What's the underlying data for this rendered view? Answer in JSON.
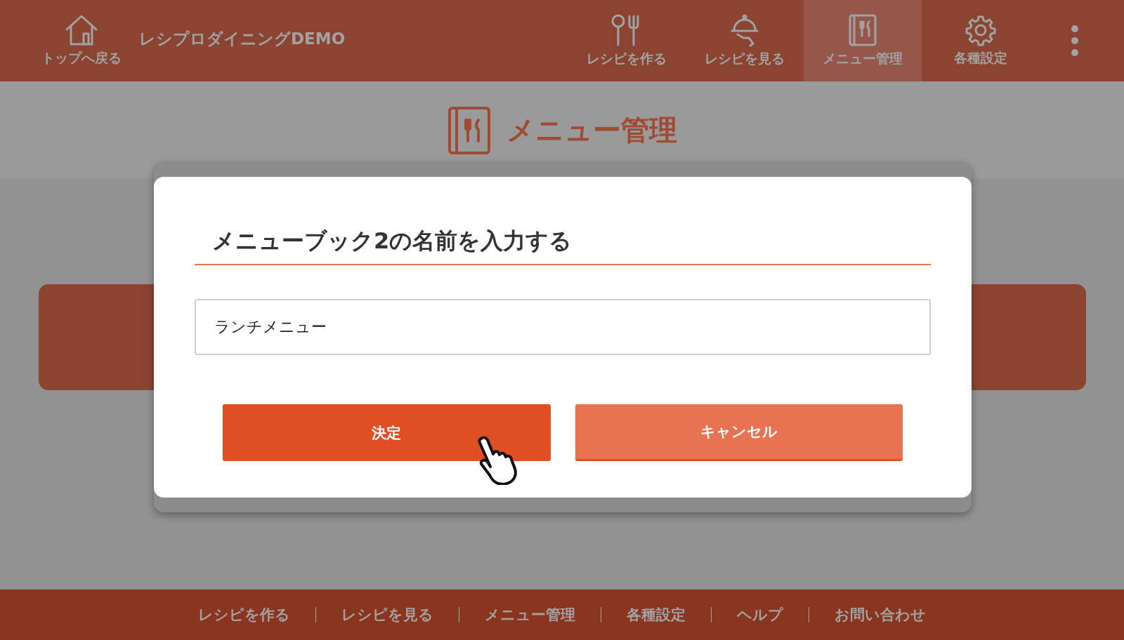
{
  "header": {
    "home_label": "トップへ戻る",
    "app_title": "レシプロダイニングDEMO",
    "nav": [
      {
        "kind": "cutlery",
        "label": "レシピを作る",
        "selected": false
      },
      {
        "kind": "cloche",
        "label": "レシピを見る",
        "selected": false
      },
      {
        "kind": "menubook",
        "label": "メニュー管理",
        "selected": true
      },
      {
        "kind": "gear",
        "label": "各種設定",
        "selected": false
      }
    ]
  },
  "page_title": "メニュー管理",
  "modal": {
    "title": "メニューブック2の名前を入力する",
    "input": {
      "value": "ランチメニュー"
    },
    "buttons": [
      {
        "kind": "primary",
        "label": "決定"
      },
      {
        "kind": "secondary",
        "label": "キャンセル"
      }
    ]
  },
  "footer": {
    "links": [
      "レシピを作る",
      "レシピを見る",
      "メニュー管理",
      "各種設定",
      "ヘルプ",
      "お問い合わせ"
    ]
  }
}
